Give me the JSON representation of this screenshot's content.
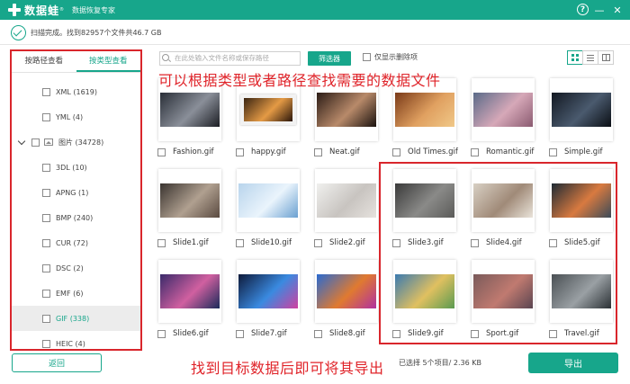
{
  "app": {
    "name": "数据蛙",
    "reg_mark": "®",
    "subtitle": "数据恢复专家"
  },
  "status": {
    "text": "扫描完成。找到82957个文件共46.7 GB"
  },
  "sidebar": {
    "tabs": [
      {
        "label": "按路径查看",
        "active": false
      },
      {
        "label": "按类型查看",
        "active": true
      }
    ],
    "items": [
      {
        "label": "XML (1619)",
        "level": 1
      },
      {
        "label": "YML (4)",
        "level": 1
      },
      {
        "label": "图片 (34728)",
        "level": 0,
        "expanded": true
      },
      {
        "label": "3DL (10)",
        "level": 1
      },
      {
        "label": "APNG (1)",
        "level": 1
      },
      {
        "label": "BMP (240)",
        "level": 1
      },
      {
        "label": "CUR (72)",
        "level": 1
      },
      {
        "label": "DSC (2)",
        "level": 1
      },
      {
        "label": "EMF (6)",
        "level": 1
      },
      {
        "label": "GIF (338)",
        "level": 1,
        "selected": true
      },
      {
        "label": "HEIC (4)",
        "level": 1
      }
    ]
  },
  "toolbar": {
    "search_placeholder": "在此处输入文件名称或保存路径",
    "filter_label": "筛选器",
    "show_deleted_label": "仅显示删除项"
  },
  "files": [
    {
      "name": "Fashion.gif",
      "colors": [
        "#2a2f38",
        "#8a8f99",
        "#1c1e24"
      ]
    },
    {
      "name": "happy.gif",
      "colors": [
        "#3a2412",
        "#e49a45",
        "#2a160a"
      ],
      "framed": true
    },
    {
      "name": "Neat.gif",
      "colors": [
        "#2b1c16",
        "#b88a6a",
        "#1a120e"
      ]
    },
    {
      "name": "Old Times.gif",
      "colors": [
        "#7a3a18",
        "#e0a060",
        "#f0c888"
      ]
    },
    {
      "name": "Romantic.gif",
      "colors": [
        "#5a6a88",
        "#d6a8b8",
        "#8a5a70"
      ]
    },
    {
      "name": "Simple.gif",
      "colors": [
        "#121822",
        "#4a5a6e",
        "#0a0e14"
      ]
    },
    {
      "name": "Slide1.gif",
      "colors": [
        "#3a3430",
        "#b0a090",
        "#5a4a40"
      ]
    },
    {
      "name": "Slide10.gif",
      "colors": [
        "#b8d4ec",
        "#eaf4fc",
        "#6aa0d0"
      ]
    },
    {
      "name": "Slide2.gif",
      "colors": [
        "#f0f0ee",
        "#c8c4c0",
        "#e6e2de"
      ]
    },
    {
      "name": "Slide3.gif",
      "colors": [
        "#3a3a3a",
        "#8a8a88",
        "#5a5a58"
      ],
      "checked": true
    },
    {
      "name": "Slide4.gif",
      "colors": [
        "#d8d0c4",
        "#a08a78",
        "#eae4da"
      ],
      "checked": true
    },
    {
      "name": "Slide5.gif",
      "colors": [
        "#1e2a34",
        "#d87a40",
        "#3a4a58"
      ],
      "checked": true
    },
    {
      "name": "Slide6.gif",
      "colors": [
        "#3a2a6a",
        "#d060a0",
        "#1a2a5a"
      ]
    },
    {
      "name": "Slide7.gif",
      "colors": [
        "#0e1a3a",
        "#3a8ae0",
        "#d040a0"
      ]
    },
    {
      "name": "Slide8.gif",
      "colors": [
        "#2a6ad0",
        "#e07a30",
        "#b030a0"
      ]
    },
    {
      "name": "Slide9.gif",
      "colors": [
        "#3a7ab0",
        "#e0c060",
        "#5a9a50"
      ],
      "checked": true
    },
    {
      "name": "Sport.gif",
      "colors": [
        "#7a5a5a",
        "#c07a70",
        "#5a4450"
      ],
      "checked": true
    },
    {
      "name": "Travel.gif",
      "colors": [
        "#4a5054",
        "#9aa0a4",
        "#2a3034"
      ],
      "checked": true
    }
  ],
  "annotations": {
    "top": "可以根据类型或者路径查找需要的数据文件",
    "bottom": "找到目标数据后即可将其导出"
  },
  "footer": {
    "back_label": "返回",
    "selected_info": "已选择 5个项目/ 2.36 KB",
    "export_label": "导出"
  },
  "colors": {
    "accent": "#17a68b",
    "highlight": "#d9262c"
  }
}
